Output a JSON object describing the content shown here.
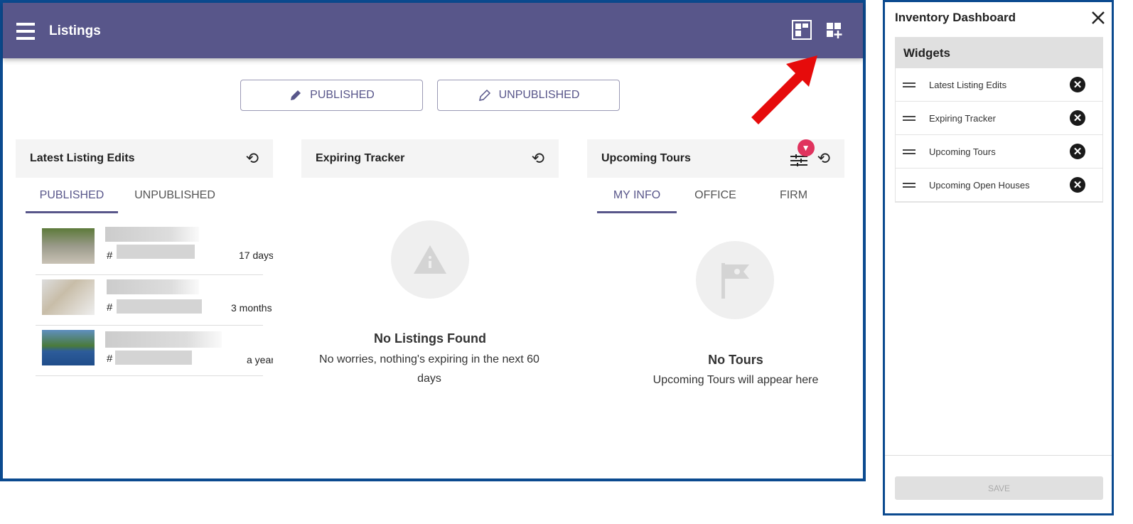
{
  "header": {
    "title": "Listings",
    "icons": [
      "dashboard-layout-icon",
      "add-widget-icon"
    ]
  },
  "toggle": {
    "published": "PUBLISHED",
    "unpublished": "UNPUBLISHED"
  },
  "widgets": {
    "latest": {
      "title": "Latest Listing Edits",
      "tabs": [
        "PUBLISHED",
        "UNPUBLISHED"
      ],
      "rows": [
        {
          "hash": "#",
          "age": "17 days"
        },
        {
          "hash": "#",
          "age": "3 months"
        },
        {
          "hash": "#",
          "age": "a year"
        }
      ]
    },
    "expiring": {
      "title": "Expiring Tracker",
      "empty_title": "No Listings Found",
      "empty_text": "No worries, nothing's expiring in the next 60 days"
    },
    "tours": {
      "title": "Upcoming Tours",
      "tabs": [
        "MY INFO",
        "OFFICE",
        "FIRM"
      ],
      "empty_title": "No Tours",
      "empty_text": "Upcoming Tours will appear here"
    }
  },
  "panel": {
    "title": "Inventory Dashboard",
    "section": "Widgets",
    "items": [
      "Latest Listing Edits",
      "Expiring Tracker",
      "Upcoming Tours",
      "Upcoming Open Houses"
    ],
    "save": "SAVE"
  },
  "colors": {
    "brand": "#58568a",
    "frame": "#0b4a8f",
    "arrow": "#e60b0b",
    "badge": "#e0335e"
  }
}
